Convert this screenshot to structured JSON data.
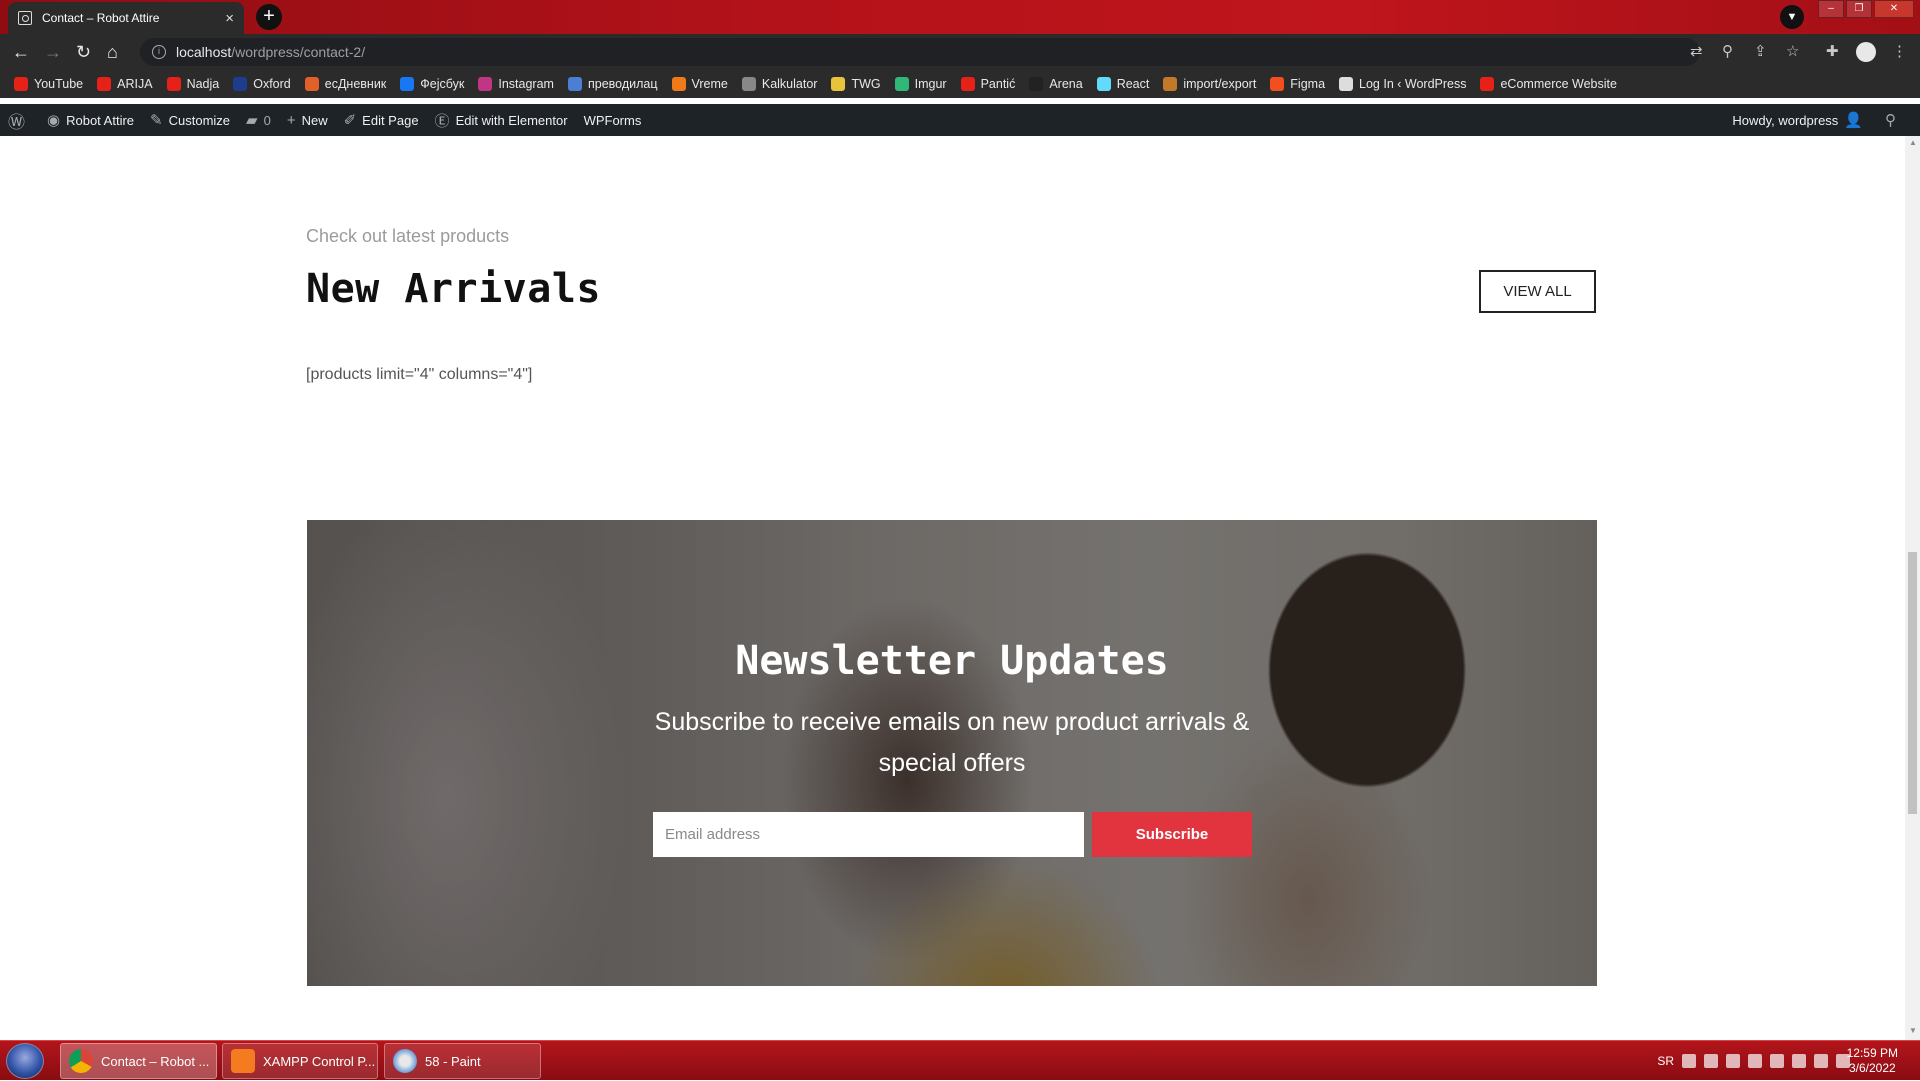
{
  "browser": {
    "tab_title": "Contact – Robot Attire",
    "tab_close": "×",
    "new_tab": "+",
    "url_host": "localhost",
    "url_path": "/wordpress/contact-2/"
  },
  "bookmarks": [
    {
      "label": "YouTube",
      "color": "#e62117"
    },
    {
      "label": "ARIJA",
      "color": "#e62117"
    },
    {
      "label": "Nadja",
      "color": "#e62117"
    },
    {
      "label": "Oxford",
      "color": "#1e3c8c"
    },
    {
      "label": "есДневник",
      "color": "#e0602a"
    },
    {
      "label": "Фејсбук",
      "color": "#1877f2"
    },
    {
      "label": "Instagram",
      "color": "#c13584"
    },
    {
      "label": "преводилац",
      "color": "#4a7fd4"
    },
    {
      "label": "Vreme",
      "color": "#f07a1a"
    },
    {
      "label": "Kalkulator",
      "color": "#888888"
    },
    {
      "label": "TWG",
      "color": "#e8c43a"
    },
    {
      "label": "Imgur",
      "color": "#2fb878"
    },
    {
      "label": "Pantić",
      "color": "#e62117"
    },
    {
      "label": "Arena",
      "color": "#222222"
    },
    {
      "label": "React",
      "color": "#61dafb"
    },
    {
      "label": "import/export",
      "color": "#c27a2a"
    },
    {
      "label": "Figma",
      "color": "#f24e1e"
    },
    {
      "label": "Log In ‹ WordPress",
      "color": "#dddddd"
    },
    {
      "label": "eCommerce Website",
      "color": "#e62117"
    }
  ],
  "wpbar": {
    "site_name": "Robot Attire",
    "customize": "Customize",
    "comments_count": "0",
    "new": "New",
    "edit_page": "Edit Page",
    "edit_elementor": "Edit with Elementor",
    "wpforms": "WPForms",
    "howdy": "Howdy, wordpress"
  },
  "section": {
    "eyebrow": "Check out latest products",
    "heading": "New Arrivals",
    "view_all": "VIEW ALL",
    "shortcode": "[products limit=\"4\" columns=\"4\"]"
  },
  "newsletter": {
    "title": "Newsletter Updates",
    "subtitle": "Subscribe to receive emails on new product arrivals & special offers",
    "email_placeholder": "Email address",
    "button": "Subscribe",
    "button_color": "#e1343f"
  },
  "taskbar": {
    "tasks": [
      "Contact – Robot ...",
      "XAMPP Control P...",
      "58 - Paint"
    ],
    "lang": "SR",
    "time": "12:59 PM",
    "date": "3/6/2022"
  }
}
